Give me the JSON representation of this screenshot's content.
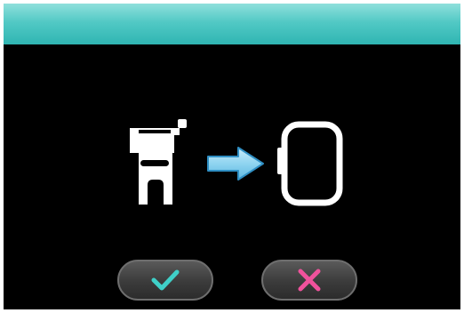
{
  "screen": {
    "title": ""
  },
  "icons": {
    "presser_foot": "presser-foot-icon",
    "arrow": "arrow-right-icon",
    "hoop": "embroidery-hoop-icon",
    "confirm": "checkmark-icon",
    "cancel": "close-icon"
  },
  "colors": {
    "header": "#52c9c5",
    "background": "#000000",
    "confirm_mark": "#3fd0c8",
    "cancel_mark": "#f0529c",
    "arrow": "#8fd4f0"
  }
}
